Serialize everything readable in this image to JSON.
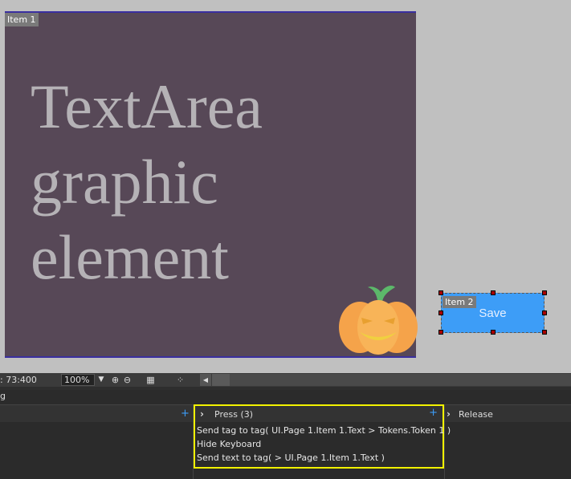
{
  "canvas": {
    "item1": {
      "tag": "Item 1",
      "text_lines": [
        "TextArea",
        "graphic",
        "element"
      ]
    },
    "item2": {
      "tag": "Item 2",
      "label": "Save"
    },
    "colors": {
      "item1_bg": "#574857",
      "item2_bg": "#3d9df7",
      "selection_yellow": "#f2f200"
    }
  },
  "statusbar": {
    "coordinates": ": 73:400",
    "zoom": "100%",
    "icons": [
      "zoom-in-icon",
      "zoom-out-icon",
      "grid-icon",
      "snap-icon"
    ]
  },
  "panel": {
    "title": "g",
    "columns": {
      "press": {
        "title": "Press (3)",
        "actions": [
          "Send tag to tag( UI.Page 1.Item 1.Text > Tokens.Token 1 )",
          "Hide Keyboard",
          "Send text to tag(  > UI.Page 1.Item 1.Text )"
        ]
      },
      "release": {
        "title": "Release"
      }
    }
  }
}
